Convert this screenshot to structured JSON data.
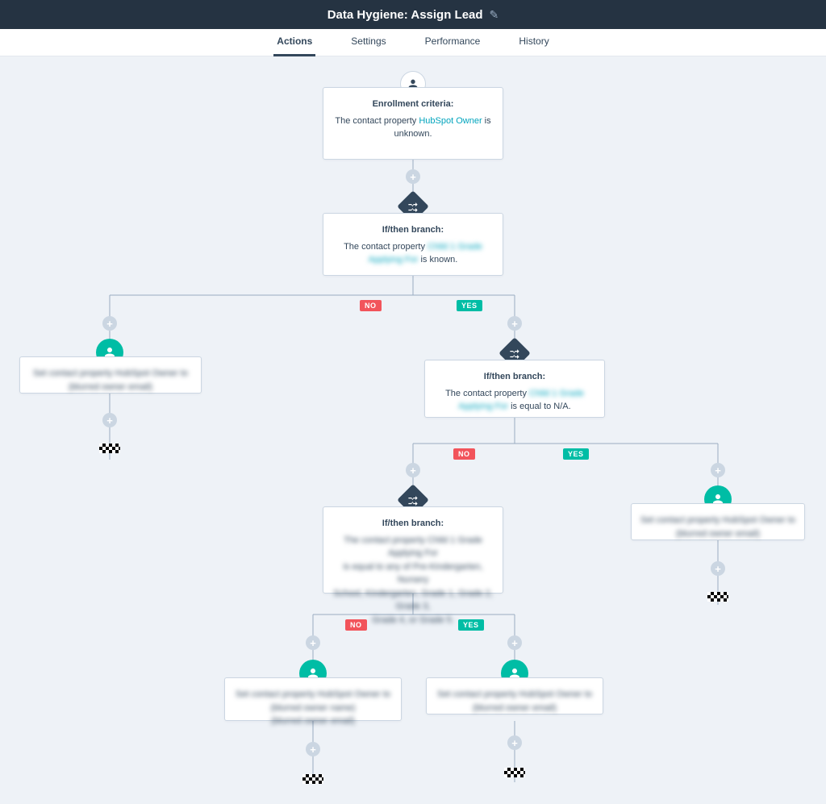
{
  "top": {
    "title": "Data Hygiene: Assign Lead"
  },
  "tabs": {
    "actions": "Actions",
    "settings": "Settings",
    "performance": "Performance",
    "history": "History"
  },
  "enroll": {
    "title": "Enrollment criteria:",
    "pre": "The contact property ",
    "link": "HubSpot Owner",
    "post": " is unknown."
  },
  "branch1": {
    "title": "If/then branch:",
    "pre": "The contact property ",
    "link": "Child 1 Grade Applying For",
    "post": " is known."
  },
  "branch2": {
    "title": "If/then branch:",
    "pre": "The contact property ",
    "link": "Child 1 Grade Applying For",
    "post": " is equal to N/A."
  },
  "branch3": {
    "title": "If/then branch:",
    "body_line1": "The contact property Child 1 Grade Applying For",
    "body_line2": "is equal to any of Pre-Kindergarten, Nursery",
    "body_line3": "School, Kindergarten, Grade 1, Grade 2, Grade 3,",
    "body_line4": "Grade 4, or Grade 5."
  },
  "action_a": {
    "line1": "Set contact property HubSpot Owner to",
    "line2": "(blurred owner email)"
  },
  "action_b": {
    "line1": "Set contact property HubSpot Owner to",
    "line2": "(blurred owner email)"
  },
  "action_c": {
    "line1": "Set contact property HubSpot Owner to",
    "line2": "(blurred owner name)",
    "line3": "(blurred owner email)"
  },
  "action_d": {
    "line1": "Set contact property HubSpot Owner to",
    "line2": "(blurred owner email)"
  },
  "labels": {
    "no": "NO",
    "yes": "YES"
  }
}
